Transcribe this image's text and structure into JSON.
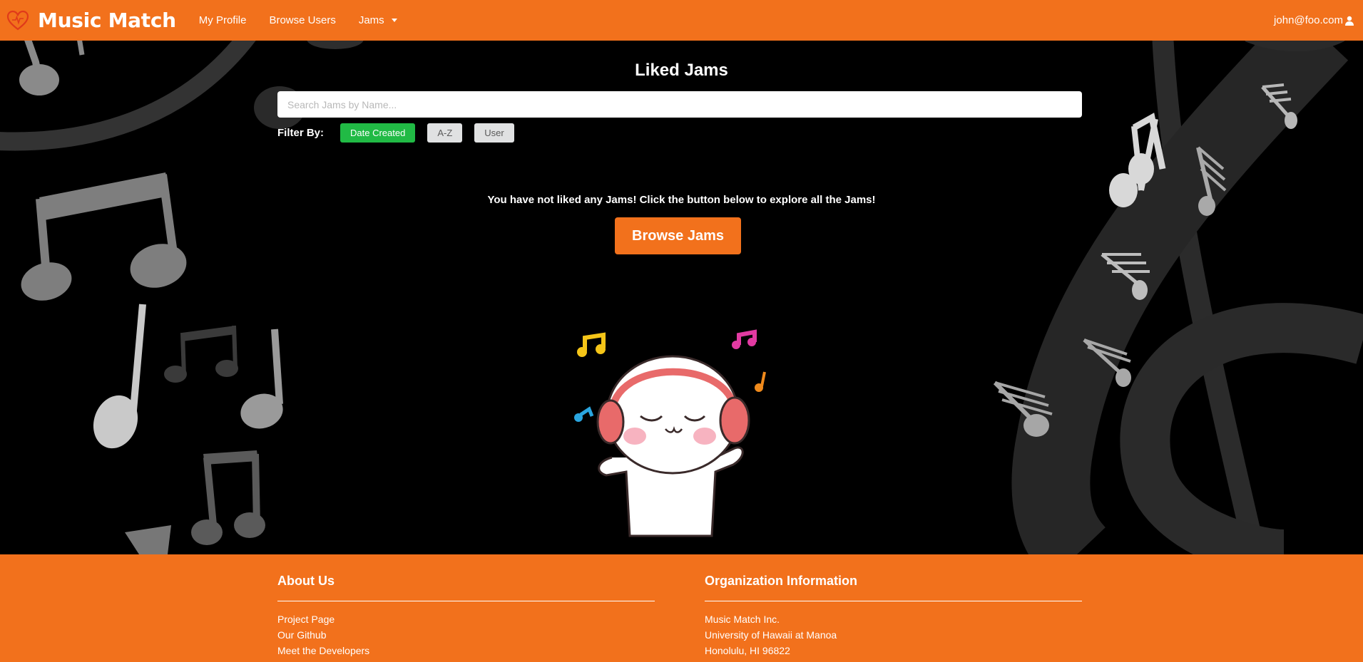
{
  "navbar": {
    "brand": "Music Match",
    "items": [
      {
        "label": "My Profile"
      },
      {
        "label": "Browse Users"
      },
      {
        "label": "Jams"
      }
    ],
    "user_email": "john@foo.com"
  },
  "main": {
    "title": "Liked Jams",
    "search_placeholder": "Search Jams by Name...",
    "filter_label": "Filter By:",
    "filters": [
      {
        "label": "Date Created",
        "active": true
      },
      {
        "label": "A-Z",
        "active": false
      },
      {
        "label": "User",
        "active": false
      }
    ],
    "empty_message": "You have not liked any Jams! Click the button below to explore all the Jams!",
    "browse_button": "Browse Jams"
  },
  "footer": {
    "about": {
      "heading": "About Us",
      "links": [
        "Project Page",
        "Our Github",
        "Meet the Developers"
      ]
    },
    "org": {
      "heading": "Organization Information",
      "lines": [
        "Music Match Inc.",
        "University of Hawaii at Manoa",
        "Honolulu, HI 96822"
      ]
    }
  },
  "colors": {
    "accent": "#f2711c",
    "active_filter": "#21ba45",
    "inactive_filter": "#e0e1e2",
    "background": "#000000"
  },
  "icons": [
    "heart-logo-icon",
    "chevron-down-icon",
    "user-icon",
    "music-note-icon"
  ]
}
